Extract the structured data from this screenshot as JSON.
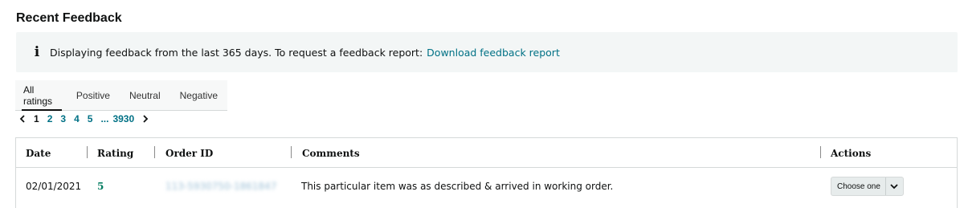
{
  "section": {
    "title": "Recent Feedback"
  },
  "info": {
    "icon": "info-icon",
    "text": "Displaying feedback from the last 365 days. To request a feedback report:",
    "link": "Download feedback report"
  },
  "tabs": [
    {
      "label": "All ratings",
      "active": true
    },
    {
      "label": "Positive",
      "active": false
    },
    {
      "label": "Neutral",
      "active": false
    },
    {
      "label": "Negative",
      "active": false
    }
  ],
  "pagination": {
    "prev_icon": "chevron-left-icon",
    "pages": [
      "1",
      "2",
      "3",
      "4",
      "5"
    ],
    "current": "1",
    "ellipsis": "...",
    "last": "3930",
    "next_icon": "chevron-right-icon"
  },
  "table": {
    "headers": {
      "date": "Date",
      "rating": "Rating",
      "order_id": "Order ID",
      "comments": "Comments",
      "actions": "Actions"
    },
    "rows": [
      {
        "date": "02/01/2021",
        "rating": "5",
        "order_id": "113-5930750-1861847",
        "comment": "This particular item was as described & arrived in working order.",
        "action_label": "Choose one"
      }
    ]
  },
  "colors": {
    "link": "#007185",
    "rating_positive": "#067d62",
    "info_bg": "#f3f6f6",
    "tab_bg": "#f7f8f8"
  }
}
